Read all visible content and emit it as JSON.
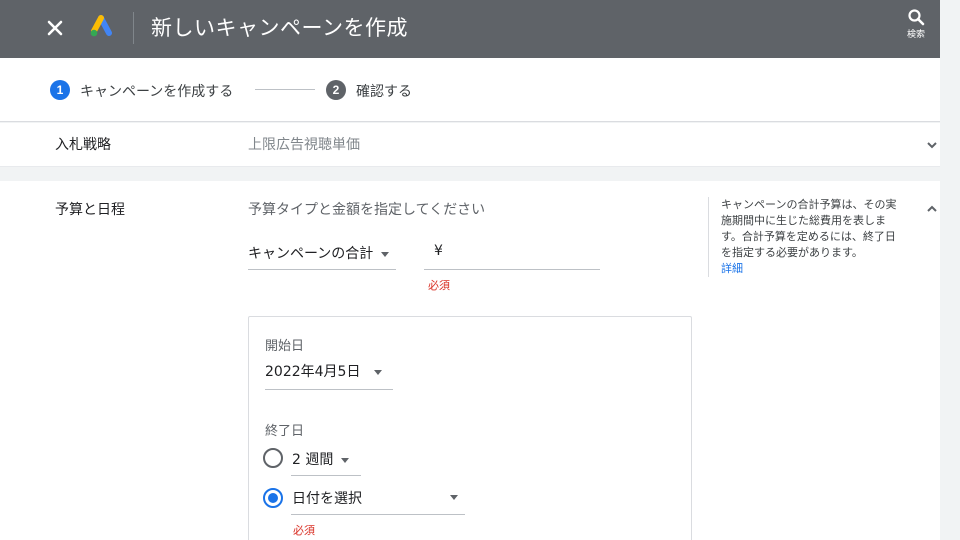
{
  "header": {
    "title": "新しいキャンペーンを作成",
    "search_label": "検索",
    "close_icon": "close-icon",
    "logo_icon": "google-ads-logo",
    "colors": {
      "bar": "#5f6368",
      "logo_blue": "#4285f4",
      "logo_yellow": "#fbbc04",
      "logo_green": "#34a853"
    }
  },
  "steps": [
    {
      "num": "1",
      "label": "キャンペーンを作成する",
      "active": true
    },
    {
      "num": "2",
      "label": "確認する",
      "active": false
    }
  ],
  "bid_strategy": {
    "label": "入札戦略",
    "value": "上限広告視聴単価"
  },
  "budget": {
    "label": "予算と日程",
    "hint": "予算タイプと金額を指定してください",
    "type_dropdown": "キャンペーンの合計",
    "currency": "¥",
    "amount": "",
    "required": "必須",
    "help_text": "キャンペーンの合計予算は、その実施期間中に生じた総費用を表します。合計予算を定めるには、終了日を指定する必要があります。",
    "help_link": "詳細",
    "start": {
      "label": "開始日",
      "value": "2022年4月5日"
    },
    "end": {
      "label": "終了日",
      "option_duration": "2 週間",
      "option_date": "日付を選択",
      "selected": "date",
      "required": "必須"
    }
  },
  "colors": {
    "accent": "#1a73e8",
    "error": "#d93025"
  }
}
